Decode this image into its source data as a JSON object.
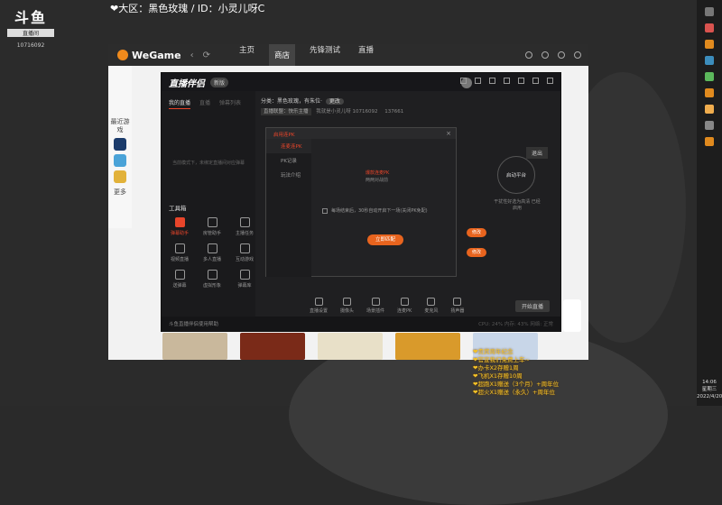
{
  "stream": {
    "platform": "斗鱼",
    "room_badge": "直播间",
    "room_id": "10716092",
    "overlay_title": "❤大区：黑色玫瑰 / ID：小灵儿呀C"
  },
  "wegame": {
    "logo": "WeGame",
    "nav": [
      {
        "label": "主页"
      },
      {
        "label": "商店",
        "active": true
      },
      {
        "label": "先锋测试"
      },
      {
        "label": "直播"
      }
    ],
    "sidebar_label": "最近游戏",
    "sidebar_more": "更多"
  },
  "helper": {
    "title": "直播伴侣",
    "version": "新版",
    "tabs": [
      "我的直播",
      "直播",
      "弹幕列表"
    ],
    "empty_text": "当前模式下，未绑定直播间对应弹幕",
    "toolbox_label": "工具箱",
    "tools": [
      {
        "label": "弹幕助手",
        "active": true
      },
      {
        "label": "房管助手"
      },
      {
        "label": "主播任务"
      },
      {
        "label": "视频直播"
      },
      {
        "label": "多人直播"
      },
      {
        "label": "互动游戏"
      },
      {
        "label": "送弹幕"
      },
      {
        "label": "虚拟形象"
      },
      {
        "label": "弹幕库"
      }
    ],
    "category": "分类：黑色玫瑰，有朱位·",
    "category_change": "更改",
    "info_tag": "直播联盟：快乐主播",
    "info_room": "我就是小灵儿呀 10716092",
    "info_fans": "137661",
    "exit_label": "退出",
    "circle_right": "启动平台",
    "circle_right_caption": "干扰性好选为高清\n已经启用",
    "orange_labels": [
      "修改",
      "修改"
    ],
    "bottom_tools": [
      "直播设置",
      "摄像头",
      "场景插件",
      "连麦PK",
      "麦克风",
      "扬声器"
    ],
    "start_live": "开始直播",
    "status_text": "斗鱼直播伴侣使用帮助",
    "status_right": "CPU: 24%   内存: 43%   网络: 正常"
  },
  "dialog": {
    "header": "启用连PK",
    "menu": [
      "连麦连PK",
      "PK记录",
      "玩法介绍"
    ],
    "line_a": "爆款连麦PK",
    "line_b": "两两对战前",
    "checkbox": "每场结束后，30秒自动开启下一场(关闭PK免配)",
    "button": "立即匹配"
  },
  "chat": [
    "❤贵宾周年纪念",
    "❤官宣我们免费上车~",
    "❤办卡X2存赠1周",
    "❤飞机X1存赠10周",
    "❤超跑X1赠送（3个月）+周年位",
    "❤超火X1赠送（永久）+周年位"
  ],
  "clock": {
    "time": "14:06",
    "day": "星期三",
    "date": "2022/4/20"
  },
  "colors": {
    "accent": "#e8452a",
    "button_orange": "#e8641e",
    "chat_yellow": "#f6c427"
  }
}
